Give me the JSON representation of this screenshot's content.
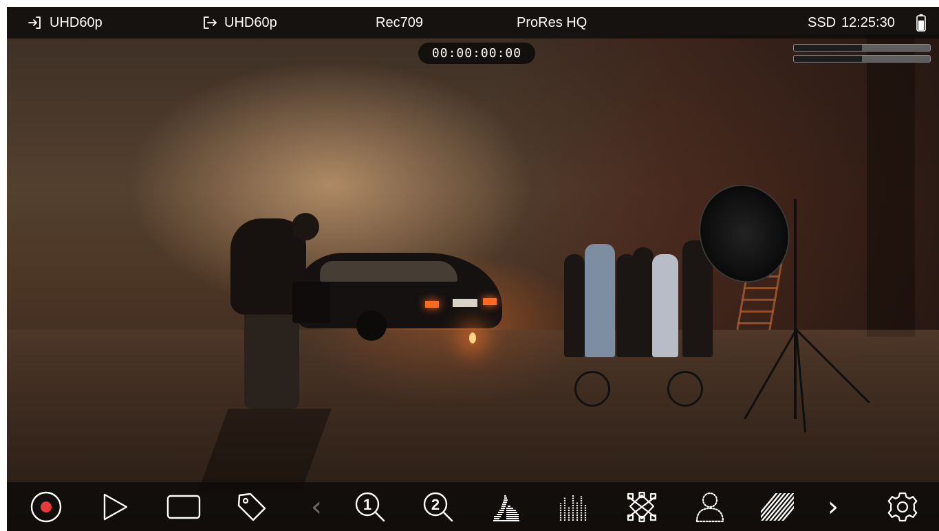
{
  "top_bar": {
    "input_format": "UHD60p",
    "output_format": "UHD60p",
    "color_space": "Rec709",
    "codec": "ProRes HQ",
    "media": "SSD",
    "clock": "12:25:30",
    "battery_level": 0.75
  },
  "timecode": "00:00:00:00",
  "audio_meters": [
    {
      "level": 0.5
    },
    {
      "level": 0.5
    }
  ],
  "bottom_toolbar": {
    "prev_glyph": "‹",
    "next_glyph": "›",
    "zoom1_digit": "1",
    "zoom2_digit": "2",
    "icons": [
      "record-icon",
      "play-icon",
      "frame-guide-icon",
      "tag-icon",
      "chevron-left-icon",
      "zoom-1-icon",
      "zoom-2-icon",
      "histogram-icon",
      "audio-levels-icon",
      "waveform-vectorscope-icon",
      "focus-peaking-icon",
      "zebra-icon",
      "chevron-right-icon",
      "settings-icon"
    ]
  },
  "colors": {
    "record_red": "#e63b3b",
    "overlay_bg": "#0c0a09",
    "text": "#ffffff"
  }
}
